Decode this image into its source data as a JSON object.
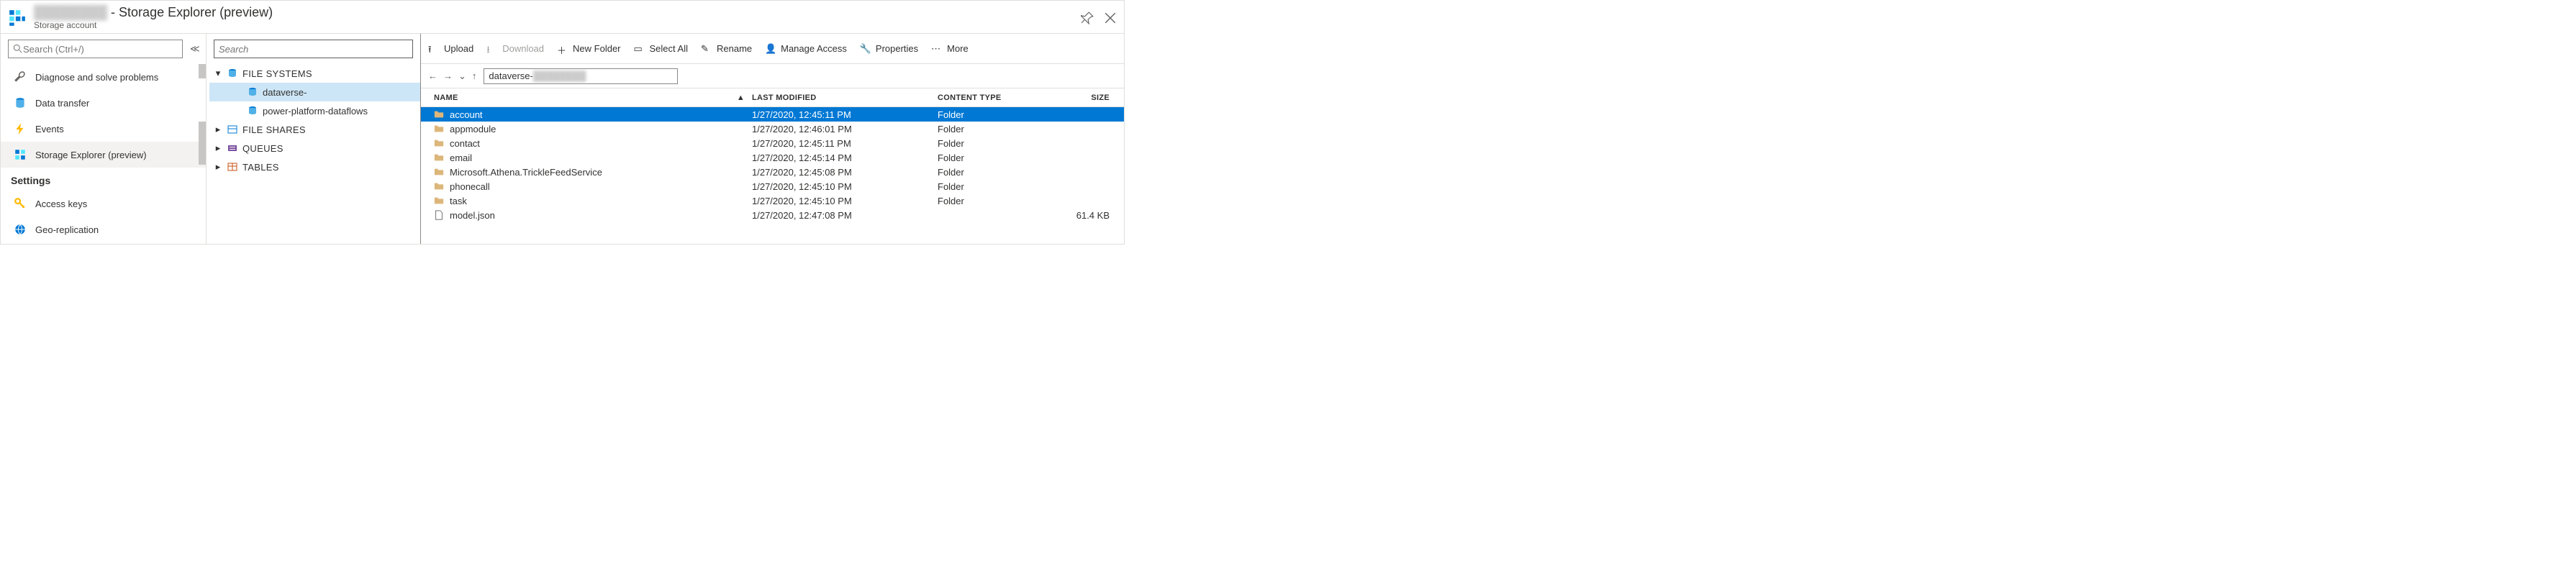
{
  "header": {
    "title_suffix": "- Storage Explorer (preview)",
    "subtitle": "Storage account"
  },
  "leftnav": {
    "search_placeholder": "Search (Ctrl+/)",
    "items": [
      {
        "label": "Diagnose and solve problems",
        "icon": "wrench"
      },
      {
        "label": "Data transfer",
        "icon": "cylinder"
      },
      {
        "label": "Events",
        "icon": "bolt"
      },
      {
        "label": "Storage Explorer (preview)",
        "icon": "grid",
        "selected": true
      }
    ],
    "section": "Settings",
    "settings_items": [
      {
        "label": "Access keys",
        "icon": "key"
      },
      {
        "label": "Geo-replication",
        "icon": "globe"
      }
    ]
  },
  "tree": {
    "search_placeholder": "Search",
    "groups": [
      {
        "label": "FILE SYSTEMS",
        "expanded": true,
        "icon": "cylinder-blue",
        "children": [
          {
            "label": "dataverse-",
            "selected": true
          },
          {
            "label": "power-platform-dataflows"
          }
        ]
      },
      {
        "label": "FILE SHARES",
        "icon": "fileshares"
      },
      {
        "label": "QUEUES",
        "icon": "queues"
      },
      {
        "label": "TABLES",
        "icon": "tables"
      }
    ]
  },
  "toolbar": {
    "upload": "Upload",
    "download": "Download",
    "newfolder": "New Folder",
    "selectall": "Select All",
    "rename": "Rename",
    "manageaccess": "Manage Access",
    "properties": "Properties",
    "more": "More"
  },
  "breadcrumb": {
    "path": "dataverse-"
  },
  "grid": {
    "columns": {
      "name": "NAME",
      "modified": "LAST MODIFIED",
      "type": "CONTENT TYPE",
      "size": "SIZE"
    },
    "rows": [
      {
        "name": "account",
        "modified": "1/27/2020, 12:45:11 PM",
        "type": "Folder",
        "size": "",
        "icon": "folder",
        "selected": true
      },
      {
        "name": "appmodule",
        "modified": "1/27/2020, 12:46:01 PM",
        "type": "Folder",
        "size": "",
        "icon": "folder"
      },
      {
        "name": "contact",
        "modified": "1/27/2020, 12:45:11 PM",
        "type": "Folder",
        "size": "",
        "icon": "folder"
      },
      {
        "name": "email",
        "modified": "1/27/2020, 12:45:14 PM",
        "type": "Folder",
        "size": "",
        "icon": "folder"
      },
      {
        "name": "Microsoft.Athena.TrickleFeedService",
        "modified": "1/27/2020, 12:45:08 PM",
        "type": "Folder",
        "size": "",
        "icon": "folder"
      },
      {
        "name": "phonecall",
        "modified": "1/27/2020, 12:45:10 PM",
        "type": "Folder",
        "size": "",
        "icon": "folder"
      },
      {
        "name": "task",
        "modified": "1/27/2020, 12:45:10 PM",
        "type": "Folder",
        "size": "",
        "icon": "folder"
      },
      {
        "name": "model.json",
        "modified": "1/27/2020, 12:47:08 PM",
        "type": "",
        "size": "61.4 KB",
        "icon": "file"
      }
    ]
  }
}
